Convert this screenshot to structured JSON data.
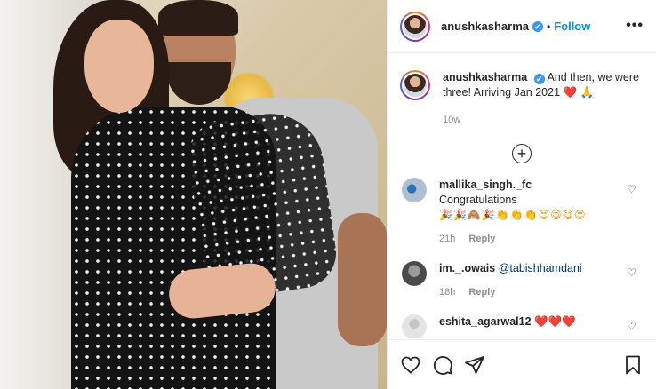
{
  "post": {
    "username": "anushkasharma",
    "follow_label": "Follow",
    "separator": "•",
    "more_icon": "more-options-icon",
    "more_label": "•••",
    "verified_glyph": "✔"
  },
  "caption": {
    "username": "anushkasharma",
    "text": "And then, we were three! Arriving Jan 2021",
    "emoji_heart": "❤️",
    "emoji_pray": "🙏",
    "time": "10w"
  },
  "load_more_label": "+",
  "comments": [
    {
      "username": "mallika_singh._fc",
      "text": "Congratulations",
      "emojis": "🎉🎉🙈🎉👏👏👏😍😋😋😍",
      "time": "21h",
      "reply": "Reply",
      "avatar_color": "#aebfd3"
    },
    {
      "username": "im._.owais",
      "mention": "@tabishhamdani",
      "time": "18h",
      "reply": "Reply",
      "avatar_color": "#6b6b6b"
    },
    {
      "username": "eshita_agarwal12",
      "emojis": "❤️❤️❤️",
      "avatar_color": "#dcdcdc"
    }
  ],
  "actions": {
    "like_icon": "heart-icon",
    "comment_icon": "comment-icon",
    "share_icon": "share-icon",
    "save_icon": "bookmark-icon"
  },
  "colors": {
    "accent": "#0095f6",
    "verified": "#3897f0",
    "muted": "#8e8e8e"
  }
}
